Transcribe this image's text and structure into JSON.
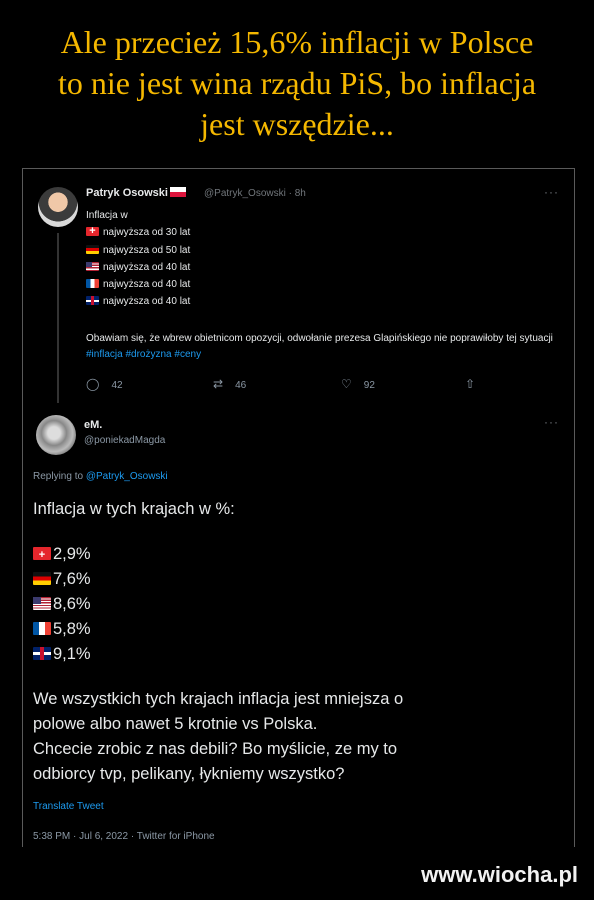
{
  "headline": {
    "line1": "Ale przecież 15,6% inflacji w Polsce",
    "line2": "to nie jest wina rządu PiS, bo inflacja",
    "line3": "jest wszędzie..."
  },
  "tweet1": {
    "name": "Patryk Osowski",
    "handle_time": "@Patryk_Osowski · 8h",
    "more": "···",
    "intro": "Inflacja w",
    "lines": [
      "najwyższa od 30 lat",
      "najwyższa od 50 lat",
      "najwyższa od 40 lat",
      "najwyższa od 40 lat",
      "najwyższa od 40 lat"
    ],
    "para_text": "Obawiam się, że wbrew obietnicom opozycji, odwołanie prezesa Glapińskiego nie poprawiłoby tej sytuacji",
    "hashtags": "#inflacja #drożyzna #ceny",
    "replies": "42",
    "retweets": "46",
    "likes": "92"
  },
  "tweet2": {
    "name": "eM.",
    "handle": "@poniekadMagda",
    "more": "···",
    "replying_label": "Replying to",
    "replying_mention": "@Patryk_Osowski",
    "heading": "Inflacja w tych krajach w %:",
    "values": [
      "2,9%",
      "7,6%",
      "8,6%",
      "5,8%",
      "9,1%"
    ],
    "para": [
      "We wszystkich tych krajach inflacja jest mniejsza o",
      "polowe albo nawet 5 krotnie vs Polska.",
      "Chcecie zrobic z nas debili? Bo myślicie, ze my to",
      "odbiorcy tvp, pelikany, łykniemy wszystko?"
    ],
    "translate": "Translate Tweet",
    "meta": "5:38 PM · Jul 6, 2022 · Twitter for iPhone"
  },
  "watermark": "www.wiocha.pl",
  "icons": {
    "reply": "reply-icon",
    "retweet": "retweet-icon",
    "like": "heart-icon",
    "share": "share-icon"
  },
  "colors": {
    "headline": "#f5b800",
    "link": "#1d9bf0",
    "background": "#000000"
  }
}
